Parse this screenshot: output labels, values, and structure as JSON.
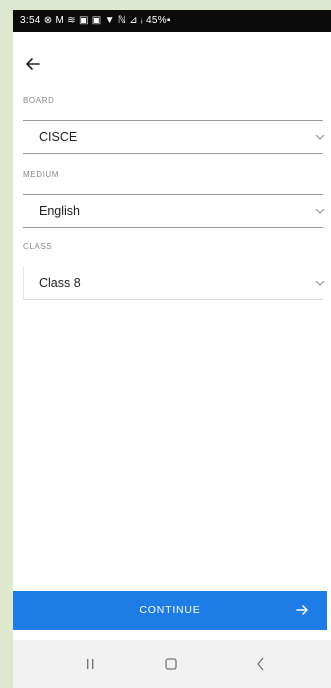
{
  "status_bar": {
    "text": "3:54 ⊗ M ≋ ▣ ▣   ▼ ℕ ⊿ ᵢ 45%▪"
  },
  "fields": [
    {
      "label": "BOARD",
      "value": "CISCE"
    },
    {
      "label": "MEDIUM",
      "value": "English"
    },
    {
      "label": "CLASS",
      "value": "Class 8"
    }
  ],
  "continue_button": {
    "label": "CONTINUE"
  },
  "icons": {
    "back": "back-arrow-icon",
    "dropdown": "chevron-down-icon",
    "continue": "arrow-right-icon",
    "nav_recents": "recents-icon",
    "nav_home": "home-icon",
    "nav_back": "nav-back-icon"
  },
  "colors": {
    "primary": "#1e7ce6",
    "status_bar": "#0b0b0b",
    "nav_bar": "#f2f2f2",
    "background": "#dde8cf"
  }
}
